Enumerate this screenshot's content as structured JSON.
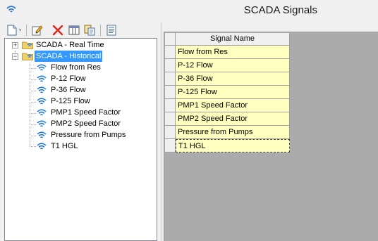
{
  "window": {
    "title": "SCADA Signals"
  },
  "toolbar": {
    "buttons": [
      {
        "name": "new-button",
        "icon": "new-document-icon"
      },
      {
        "name": "edit-button",
        "icon": "edit-icon"
      },
      {
        "name": "delete-button",
        "icon": "delete-icon"
      },
      {
        "name": "table-button",
        "icon": "table-icon"
      },
      {
        "name": "copy-button",
        "icon": "copy-icon"
      },
      {
        "name": "report-button",
        "icon": "report-icon"
      }
    ]
  },
  "tree": {
    "groups": [
      {
        "label": "SCADA - Real Time",
        "expanded": false,
        "selected": false
      },
      {
        "label": "SCADA - Historical",
        "expanded": true,
        "selected": true
      }
    ],
    "signals": [
      "Flow from Res",
      "P-12 Flow",
      "P-36 Flow",
      "P-125 Flow",
      "PMP1 Speed Factor",
      "PMP2 Speed Factor",
      "Pressure from Pumps",
      "T1 HGL"
    ]
  },
  "grid": {
    "column_header": "Signal Name",
    "rows": [
      "Flow from Res",
      "P-12 Flow",
      "P-36 Flow",
      "P-125 Flow",
      "PMP1 Speed Factor",
      "PMP2 Speed Factor",
      "Pressure from Pumps",
      "T1 HGL"
    ],
    "current_row": 7
  },
  "colors": {
    "selection": "#3399ff",
    "cell_fill": "#ffffc0",
    "grid_background": "#ababab",
    "signal_icon": "#1e73d8"
  }
}
